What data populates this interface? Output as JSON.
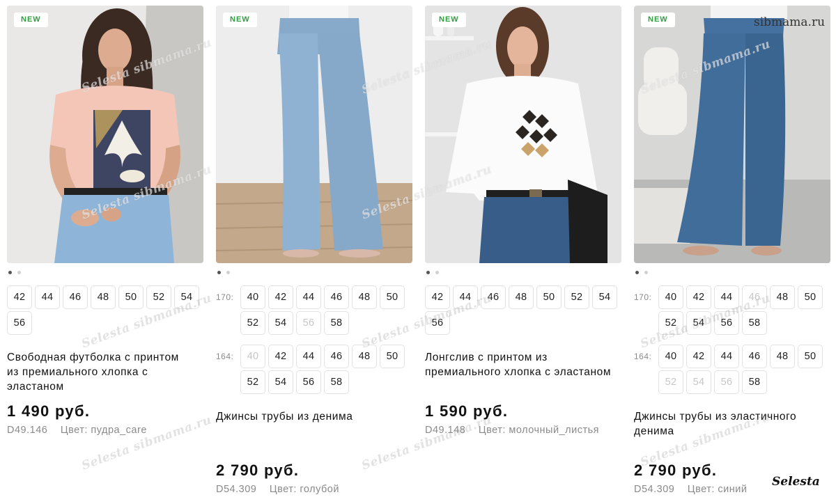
{
  "colors": {
    "accent": "#2e9e3e",
    "text": "#111111",
    "muted": "#8a8a8a",
    "disabled": "#c6c6c6"
  },
  "watermarks": {
    "diagonal": "Selesta sibmama.ru",
    "site": "sibmama.ru",
    "brand": "Selesta"
  },
  "products": [
    {
      "badge": "NEW",
      "size_groups": [
        {
          "label": "",
          "sizes": [
            "42",
            "44",
            "46",
            "48",
            "50",
            "52",
            "54",
            "56"
          ],
          "unavailable": []
        }
      ],
      "title": "Свободная футболка с принтом из премиального хлопка с эластаном",
      "price": "1 490 руб.",
      "article": "D49.146",
      "color": "Цвет: пудра_care"
    },
    {
      "badge": "NEW",
      "size_groups": [
        {
          "label": "170:",
          "sizes": [
            "40",
            "42",
            "44",
            "46",
            "48",
            "50",
            "52",
            "54",
            "56",
            "58"
          ],
          "unavailable": [
            "56"
          ]
        },
        {
          "label": "164:",
          "sizes": [
            "40",
            "42",
            "44",
            "46",
            "48",
            "50",
            "52",
            "54",
            "56",
            "58"
          ],
          "unavailable": [
            "40"
          ]
        }
      ],
      "title": "Джинсы трубы из денима",
      "price": "2 790 руб.",
      "article": "D54.309",
      "color": "Цвет: голубой"
    },
    {
      "badge": "NEW",
      "size_groups": [
        {
          "label": "",
          "sizes": [
            "42",
            "44",
            "46",
            "48",
            "50",
            "52",
            "54",
            "56"
          ],
          "unavailable": []
        }
      ],
      "title": "Лонгслив с принтом из премиального хлопка с эластаном",
      "price": "1 590 руб.",
      "article": "D49.148",
      "color": "Цвет: молочный_листья"
    },
    {
      "badge": "NEW",
      "size_groups": [
        {
          "label": "170:",
          "sizes": [
            "40",
            "42",
            "44",
            "46",
            "48",
            "50",
            "52",
            "54",
            "56",
            "58"
          ],
          "unavailable": [
            "46"
          ]
        },
        {
          "label": "164:",
          "sizes": [
            "40",
            "42",
            "44",
            "46",
            "48",
            "50",
            "52",
            "54",
            "56",
            "58"
          ],
          "unavailable": [
            "52",
            "54",
            "56"
          ]
        }
      ],
      "title": "Джинсы трубы из эластичного денима",
      "price": "2 790 руб.",
      "article": "D54.309",
      "color": "Цвет: синий"
    }
  ]
}
